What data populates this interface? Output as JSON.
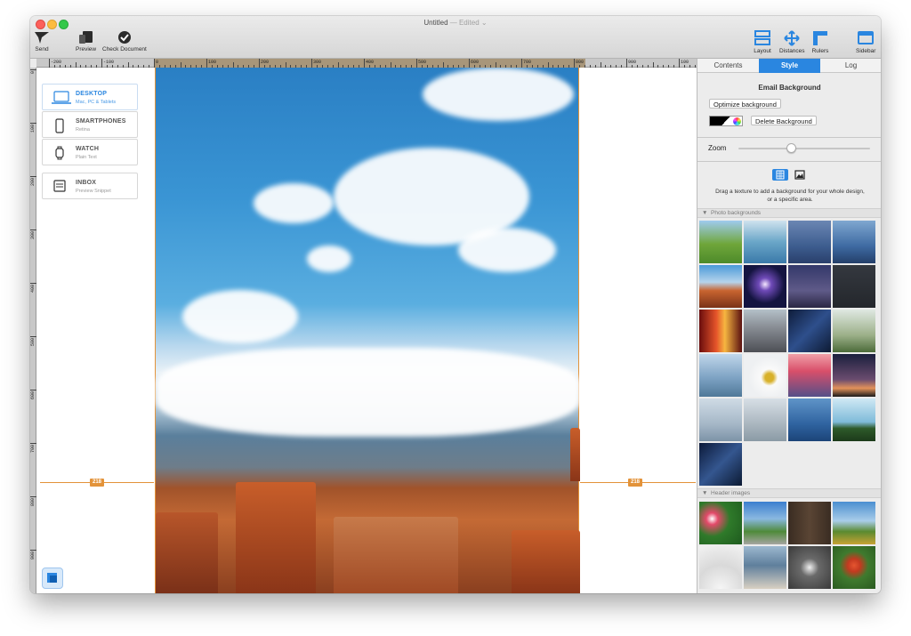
{
  "window": {
    "title": "Untitled",
    "title_state": "— Edited ⌄"
  },
  "toolbar": {
    "send_label": "Send",
    "preview_label": "Preview",
    "check_label": "Check Document",
    "layout_label": "Layout",
    "distances_label": "Distances",
    "rulers_label": "Rulers",
    "sidebar_label": "Sidebar",
    "accent": "#2a86e0"
  },
  "ruler_top": [
    "-200",
    "-100",
    "0",
    "100",
    "200",
    "300",
    "400",
    "500",
    "600",
    "700",
    "800",
    "900",
    "100"
  ],
  "ruler_left": [
    "0",
    "100",
    "200",
    "300",
    "400",
    "500",
    "600",
    "700",
    "800",
    "900"
  ],
  "devices": [
    {
      "name": "DESKTOP",
      "sub": "Mac, PC & Tablets",
      "icon": "laptop-icon",
      "active": true
    },
    {
      "name": "SMARTPHONES",
      "sub": "Retina",
      "icon": "phone-icon",
      "active": false
    },
    {
      "name": "WATCH",
      "sub": "Plain Text",
      "icon": "watch-icon",
      "active": false
    },
    {
      "name": "INBOX",
      "sub": "Preview Snippet",
      "icon": "inbox-icon",
      "active": false
    }
  ],
  "canvas": {
    "left_distance": "218",
    "right_distance": "218",
    "guide_color": "#e3933a"
  },
  "sidebar": {
    "tabs": [
      "Contents",
      "Style",
      "Log"
    ],
    "active_tab": "Style",
    "section_title": "Email Background",
    "optimize_label": "Optimize background",
    "delete_label": "Delete Background",
    "zoom_label": "Zoom",
    "zoom_value": 0.4,
    "hint": "Drag a texture to add a background for your whole design, or a specific area.",
    "group_photo": "Photo backgrounds",
    "group_header": "Header images"
  }
}
